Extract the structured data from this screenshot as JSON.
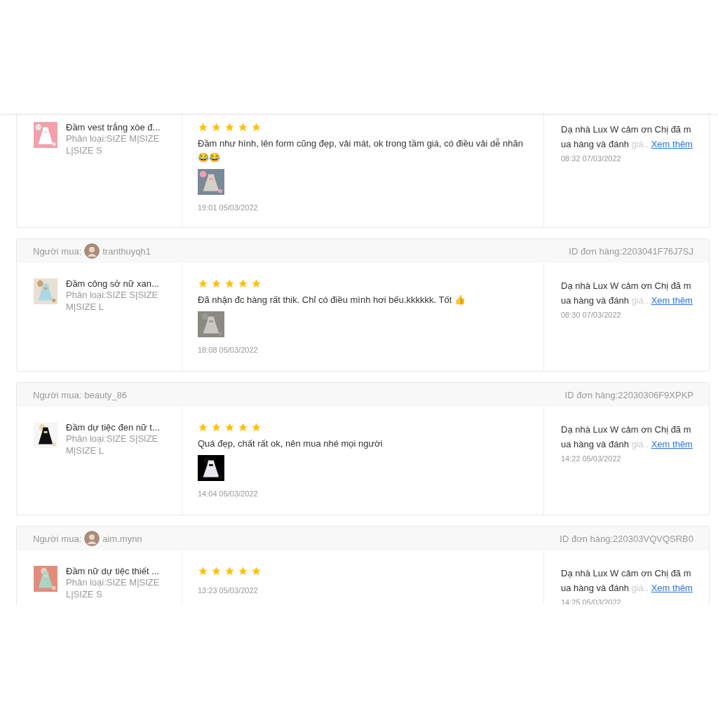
{
  "reviews": [
    {
      "product": {
        "name": "Đầm vest trắng xòe đ...",
        "variant": "Phân loại:SIZE M|SIZE L|SIZE S",
        "image": {
          "kind": "picture"
        }
      },
      "stars": 5,
      "comment": "Đầm như hình, lên form cũng đẹp, vải mát, ok trong tầm giá, có điều vải dễ nhăn 😂😂",
      "photos": [
        {
          "kind": "picture"
        }
      ],
      "time": "19:01 05/03/2022",
      "reply": {
        "text": "Dạ nhà Lux W cảm ơn Chị đã mua hàng và đánh",
        "faded": "giá..",
        "link": "Xem thêm",
        "time": "08:32 07/03/2022"
      }
    },
    {
      "buyer": {
        "label": "Người mua:",
        "avatar": true,
        "name": "tranthuyqh1",
        "order_id": "ID đơn hàng:2203041F76J7SJ"
      },
      "product": {
        "name": "Đầm công sở nữ xan...",
        "variant": "Phân loại:SIZE S|SIZE M|SIZE L",
        "image": {
          "kind": "picture"
        }
      },
      "stars": 5,
      "comment": "Đã nhận đc hàng rất thik. Chỉ có điều mình hơi bếu.kkkkkk. Tốt 👍",
      "photos": [
        {
          "kind": "picture"
        }
      ],
      "time": "18:08 05/03/2022",
      "reply": {
        "text": "Dạ nhà Lux W cảm ơn Chị đã mua hàng và đánh",
        "faded": "giá..",
        "link": "Xem thêm",
        "time": "08:30 07/03/2022"
      }
    },
    {
      "buyer": {
        "label": "Người mua:",
        "avatar": false,
        "name": "beauty_86",
        "order_id": "ID đơn hàng:22030306F9XPKP"
      },
      "product": {
        "name": "Đầm dự tiệc đen nữ t...",
        "variant": "Phân loại:SIZE S|SIZE M|SIZE L",
        "image": {
          "kind": "picture"
        }
      },
      "stars": 5,
      "comment": "Quá đẹp, chất rất ok, nên mua nhé mọi người",
      "photos": [
        {
          "kind": "picture"
        }
      ],
      "time": "14:04 05/03/2022",
      "reply": {
        "text": "Dạ nhà Lux W cảm ơn Chị đã mua hàng và đánh",
        "faded": "giá..",
        "link": "Xem thêm",
        "time": "14:22 05/03/2022"
      }
    },
    {
      "buyer": {
        "label": "Người mua:",
        "avatar": true,
        "name": "aim.mynn",
        "order_id": "ID đơn hàng:220303VQVQSRB0"
      },
      "product": {
        "name": "Đầm nữ dự tiệc thiết ...",
        "variant": "Phân loại:SIZE M|SIZE L|SIZE S",
        "image": {
          "kind": "picture"
        }
      },
      "stars": 5,
      "time": "13:23 05/03/2022",
      "reply": {
        "text": "Dạ nhà Lux W cảm ơn Chị đã mua hàng và đánh",
        "faded": "giá..",
        "link": "Xem thêm",
        "time": "14:25 05/03/2022"
      }
    }
  ]
}
